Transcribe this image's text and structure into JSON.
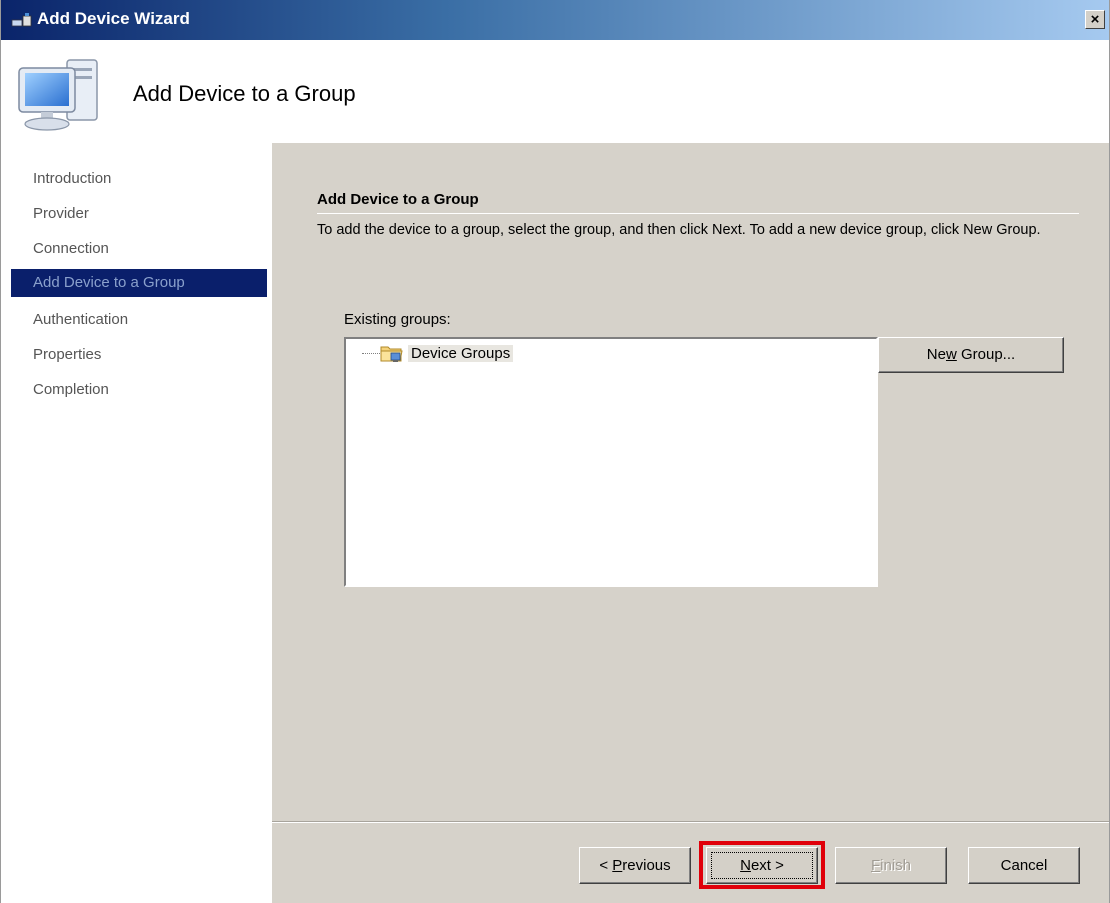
{
  "window": {
    "title": "Add Device Wizard",
    "close_label": "×"
  },
  "header": {
    "title": "Add Device to a Group"
  },
  "steps": [
    {
      "label": "Introduction",
      "active": false
    },
    {
      "label": "Provider",
      "active": false
    },
    {
      "label": "Connection",
      "active": false
    },
    {
      "label": "Add Device to a Group",
      "active": true
    },
    {
      "label": "Authentication",
      "active": false
    },
    {
      "label": "Properties",
      "active": false
    },
    {
      "label": "Completion",
      "active": false
    }
  ],
  "content": {
    "section_title": "Add Device to a Group",
    "instructions": "To add the device to a group, select the group, and then click Next. To add a new device group, click New Group.",
    "groups_label": "Existing groups:",
    "tree_root": "Device Groups",
    "new_group_button": {
      "pre": "Ne",
      "mnemonic": "w",
      "post": " Group..."
    }
  },
  "footer": {
    "previous": {
      "pre": "< ",
      "mnemonic": "P",
      "post": "revious"
    },
    "next": {
      "pre": "",
      "mnemonic": "N",
      "post": "ext >"
    },
    "finish": {
      "pre": "",
      "mnemonic": "F",
      "post": "inish"
    },
    "cancel": "Cancel"
  },
  "colors": {
    "highlight": "#e0000a",
    "active_step_bg": "#0a1f6b",
    "content_bg": "#d6d2ca"
  }
}
